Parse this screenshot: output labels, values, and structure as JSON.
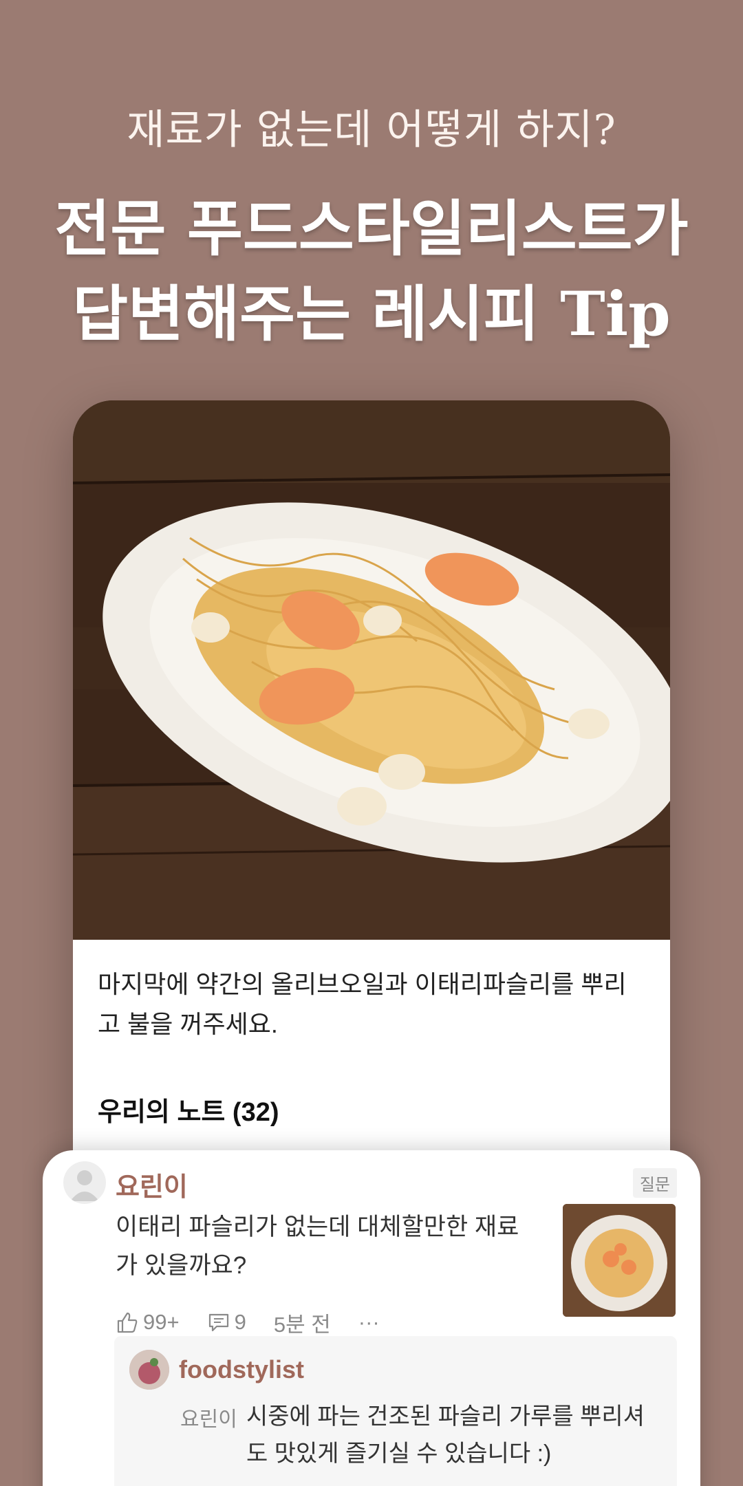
{
  "headline": {
    "subtitle": "재료가 없는데 어떻게 하지?",
    "title_line1": "전문 푸드스타일리스트가",
    "title_line2": "답변해주는 레시피 Tip"
  },
  "recipe": {
    "step_text": "마지막에 약간의 올리브오일과 이태리파슬리를 뿌리고 불을 꺼주세요.",
    "notes_title": "우리의 노트 (32)"
  },
  "comment": {
    "author": "요린이",
    "badge": "질문",
    "text": "이태리 파슬리가 없는데 대체할만한 재료가 있을까요?",
    "likes": "99+",
    "replies": "9",
    "time": "5분 전",
    "more": "···"
  },
  "reply": {
    "author": "foodstylist",
    "mention": "요린이",
    "text": "시중에 파는 건조된 파슬리 가루를 뿌리셔도 맛있게 즐기실 수 있습니다 :)"
  },
  "colors": {
    "background": "#9b7b72",
    "accent": "#a0685a"
  }
}
